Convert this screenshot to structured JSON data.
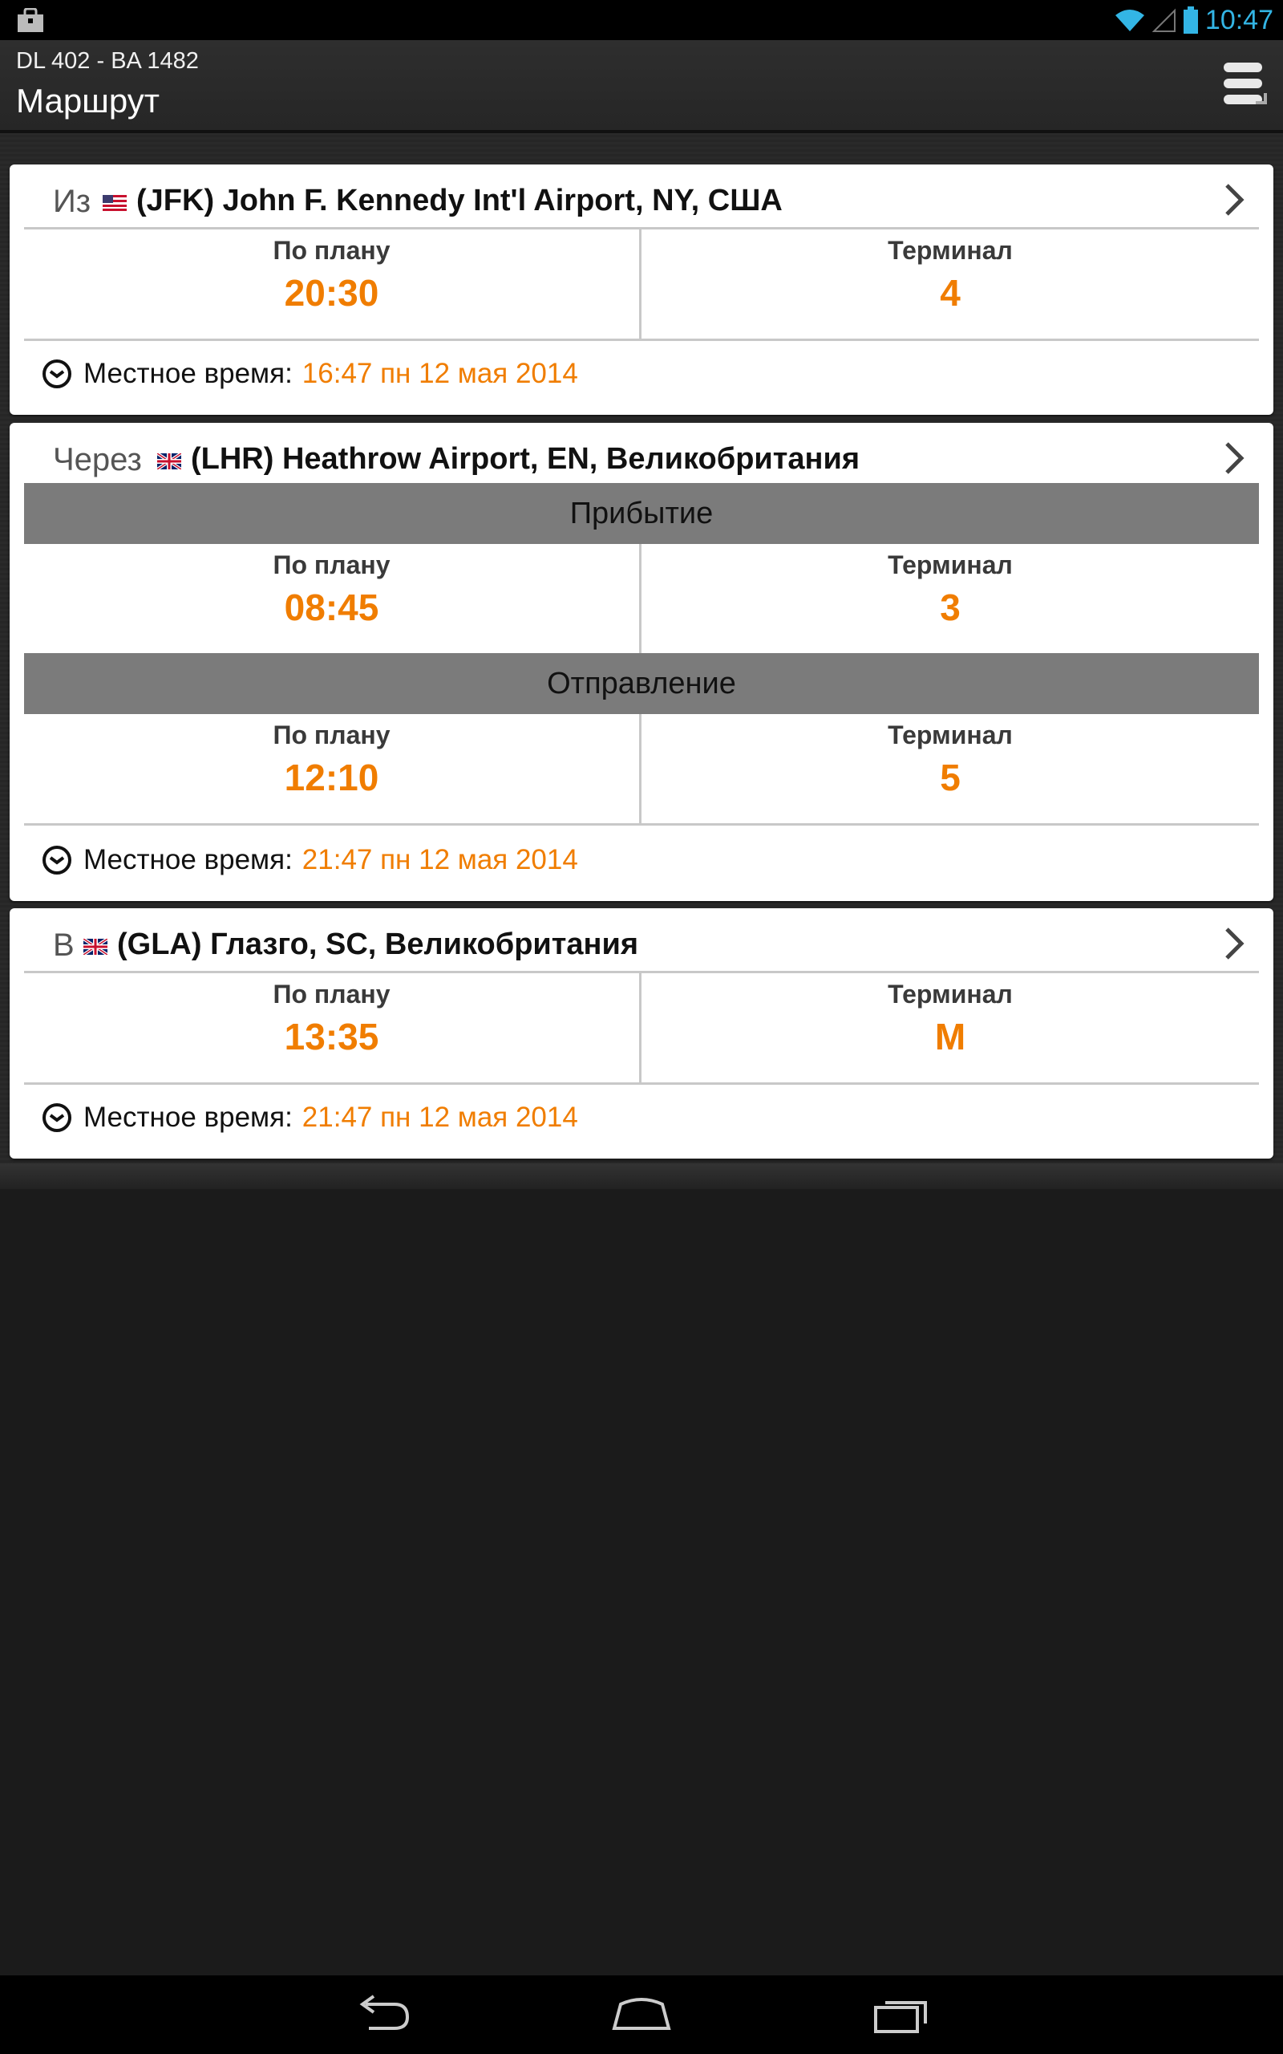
{
  "status_bar": {
    "time": "10:47",
    "icons": [
      "shopping-bag-icon",
      "wifi-icon",
      "signal-icon",
      "battery-icon"
    ],
    "accent_color": "#33b5e5"
  },
  "action_bar": {
    "subtitle": "DL 402 - BA 1482",
    "title": "Маршрут",
    "menu_icon": "overflow-menu-icon"
  },
  "colors": {
    "accent": "#f07d00",
    "band": "#7b7b7b"
  },
  "route": [
    {
      "prefix": "Из",
      "flag": "us-flag-icon",
      "airport": "(JFK) John F. Kennedy Int'l Airport, NY, США",
      "scheduled_label": "По плану",
      "scheduled": "20:30",
      "terminal_label": "Терминал",
      "terminal": "4",
      "local_label": "Местное время:",
      "local_time": "16:47 пн 12 мая 2014"
    },
    {
      "prefix": "Через",
      "flag": "uk-flag-icon",
      "airport": "(LHR) Heathrow Airport, EN, Великобритания",
      "arrival_band": "Прибытие",
      "arrival": {
        "scheduled_label": "По плану",
        "scheduled": "08:45",
        "terminal_label": "Терминал",
        "terminal": "3"
      },
      "departure_band": "Отправление",
      "departure": {
        "scheduled_label": "По плану",
        "scheduled": "12:10",
        "terminal_label": "Терминал",
        "terminal": "5"
      },
      "local_label": "Местное время:",
      "local_time": "21:47 пн 12 мая 2014"
    },
    {
      "prefix": "В",
      "flag": "uk-flag-icon",
      "airport": "(GLA) Глазго, SC, Великобритания",
      "scheduled_label": "По плану",
      "scheduled": "13:35",
      "terminal_label": "Терминал",
      "terminal": "M",
      "local_label": "Местное время:",
      "local_time": "21:47 пн 12 мая 2014"
    }
  ],
  "nav_bar": {
    "icons": [
      "back-icon",
      "home-icon",
      "recent-apps-icon"
    ]
  }
}
